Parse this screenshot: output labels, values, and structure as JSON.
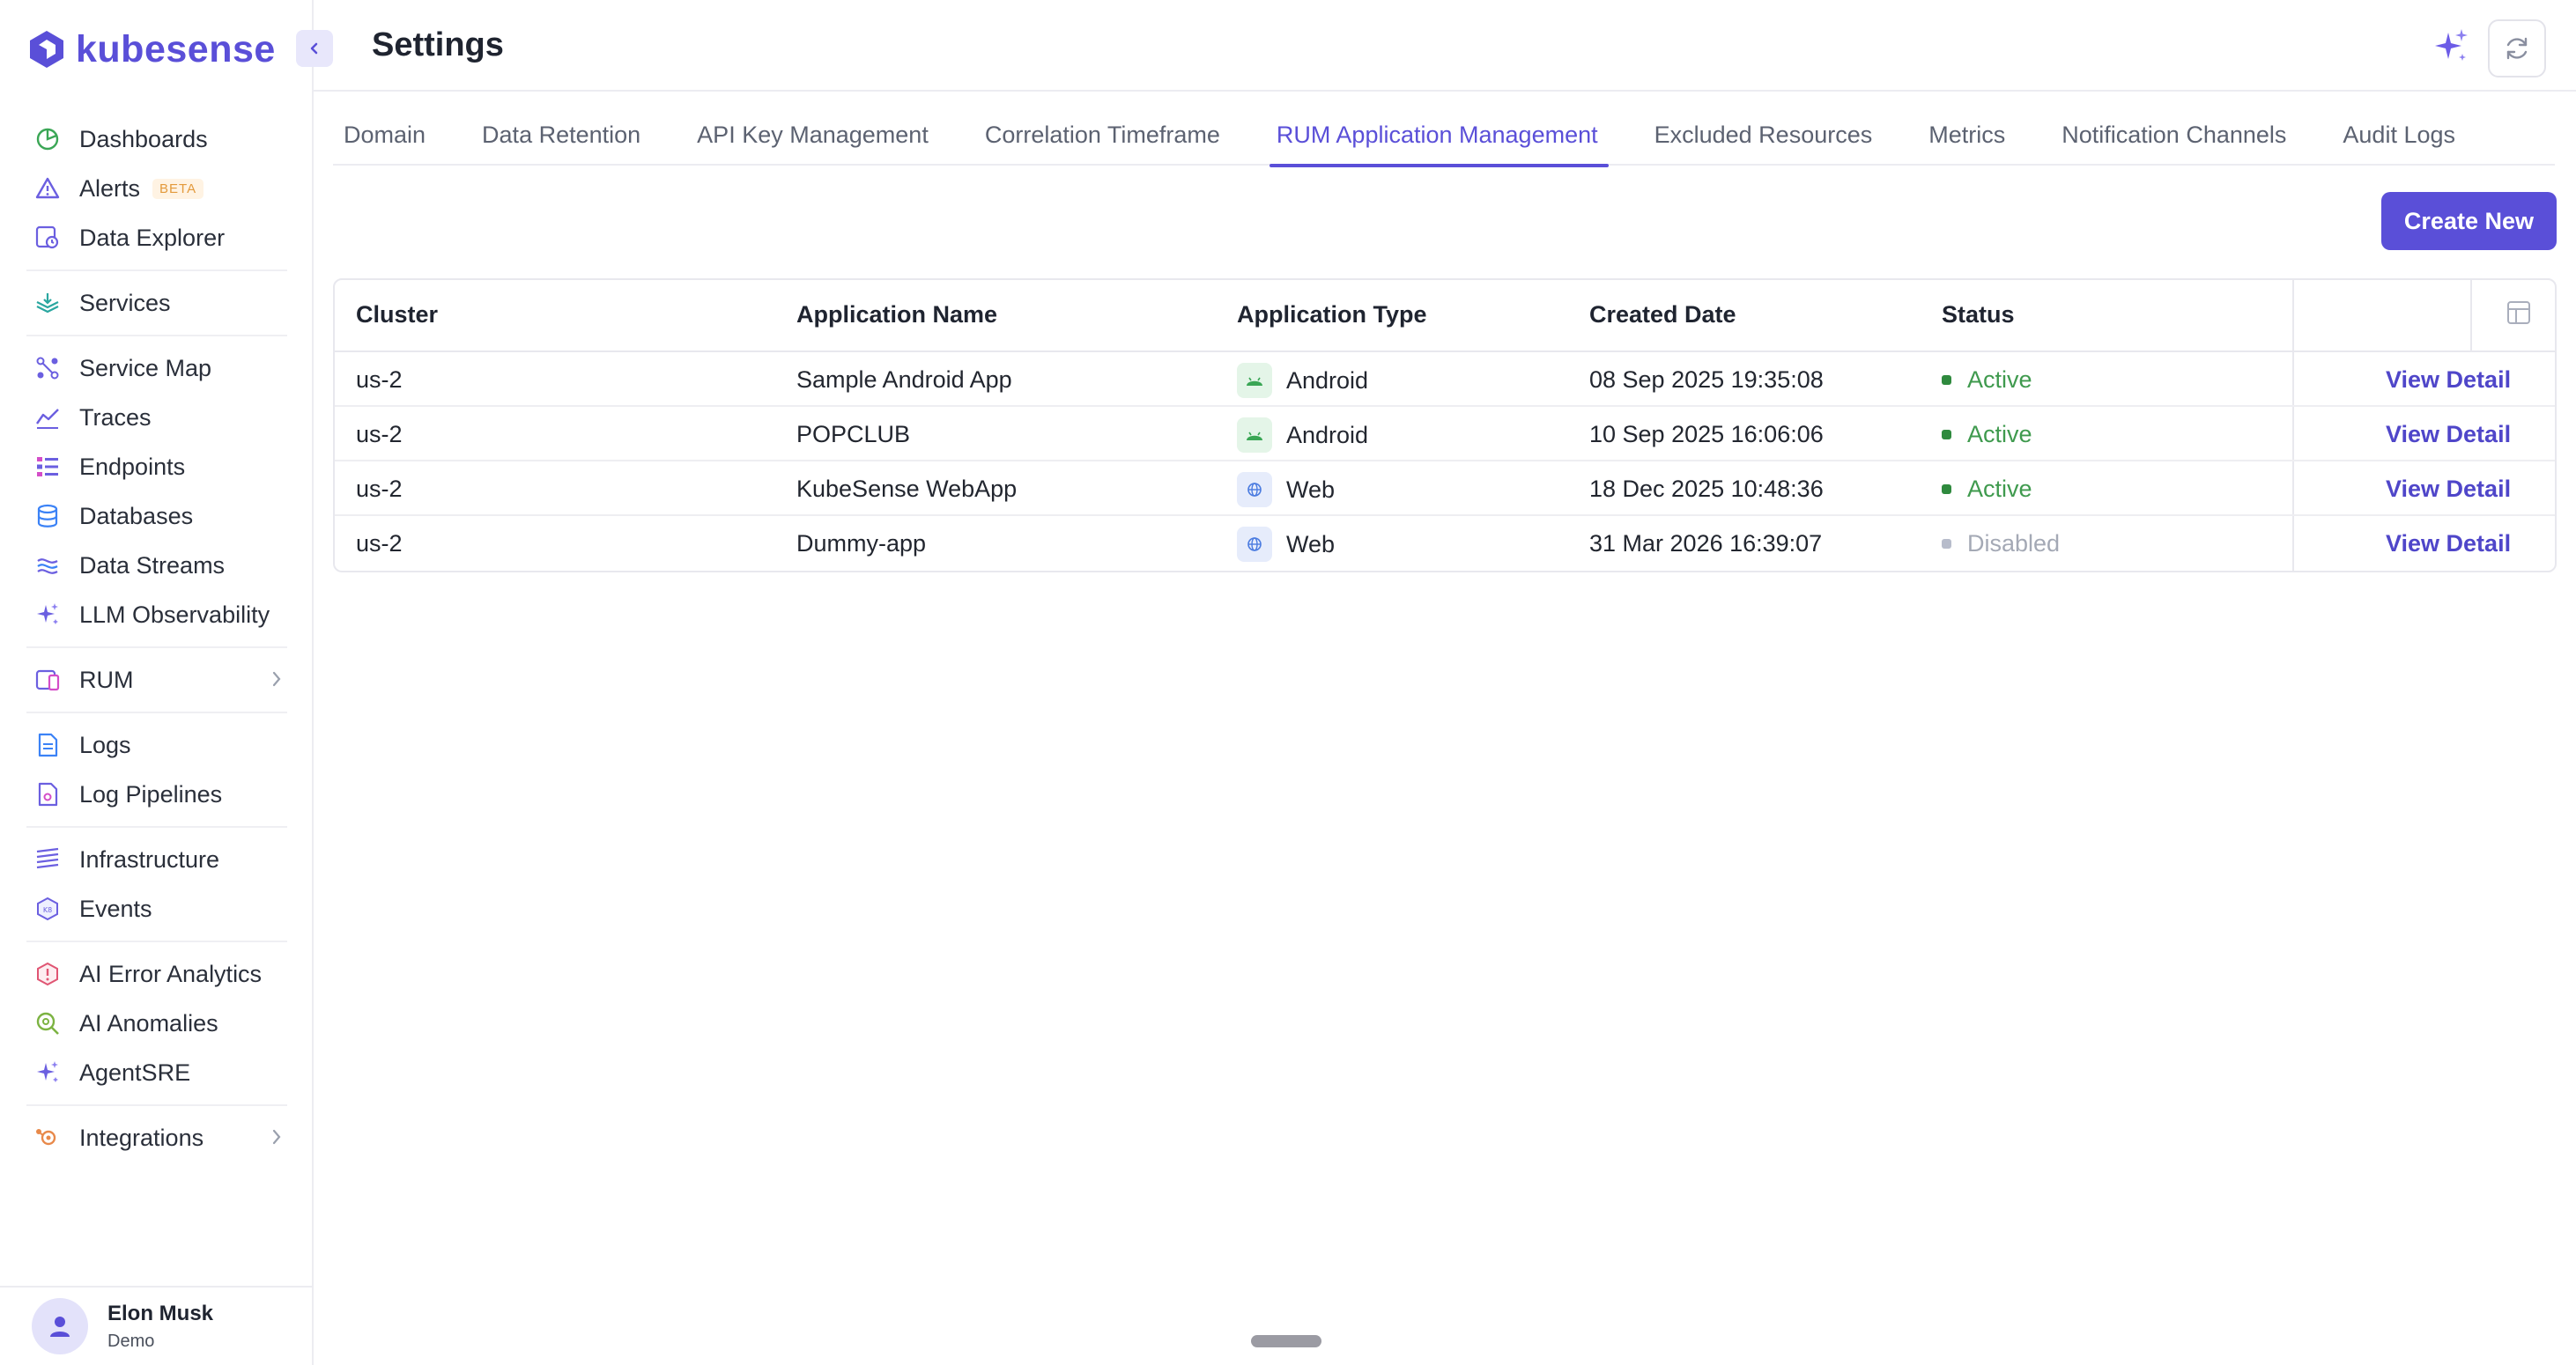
{
  "app": {
    "brand": "kubesense",
    "accent": "#5a4fd8"
  },
  "header": {
    "title": "Settings"
  },
  "sidebar": {
    "groups": [
      {
        "items": [
          {
            "label": "Dashboards",
            "icon": "dashboard-icon"
          },
          {
            "label": "Alerts",
            "icon": "alert-icon",
            "badge": "BETA"
          },
          {
            "label": "Data Explorer",
            "icon": "data-explorer-icon"
          }
        ]
      },
      {
        "items": [
          {
            "label": "Services",
            "icon": "services-icon"
          }
        ]
      },
      {
        "items": [
          {
            "label": "Service Map",
            "icon": "service-map-icon"
          },
          {
            "label": "Traces",
            "icon": "traces-icon"
          },
          {
            "label": "Endpoints",
            "icon": "endpoints-icon"
          },
          {
            "label": "Databases",
            "icon": "database-icon"
          },
          {
            "label": "Data Streams",
            "icon": "data-streams-icon"
          },
          {
            "label": "LLM Observability",
            "icon": "sparkle-icon"
          }
        ]
      },
      {
        "items": [
          {
            "label": "RUM",
            "icon": "rum-icon",
            "expandable": true
          }
        ]
      },
      {
        "items": [
          {
            "label": "Logs",
            "icon": "logs-icon"
          },
          {
            "label": "Log Pipelines",
            "icon": "log-pipelines-icon"
          }
        ]
      },
      {
        "items": [
          {
            "label": "Infrastructure",
            "icon": "infrastructure-icon"
          },
          {
            "label": "Events",
            "icon": "events-icon"
          }
        ]
      },
      {
        "items": [
          {
            "label": "AI Error Analytics",
            "icon": "ai-error-icon"
          },
          {
            "label": "AI Anomalies",
            "icon": "ai-anomalies-icon"
          },
          {
            "label": "AgentSRE",
            "icon": "sparkle-icon"
          }
        ]
      },
      {
        "items": [
          {
            "label": "Integrations",
            "icon": "integrations-icon",
            "expandable": true
          }
        ]
      }
    ],
    "user": {
      "name": "Elon Musk",
      "org": "Demo"
    }
  },
  "tabs": [
    {
      "label": "Domain"
    },
    {
      "label": "Data Retention"
    },
    {
      "label": "API Key Management"
    },
    {
      "label": "Correlation Timeframe"
    },
    {
      "label": "RUM Application Management",
      "active": true
    },
    {
      "label": "Excluded Resources"
    },
    {
      "label": "Metrics"
    },
    {
      "label": "Notification Channels"
    },
    {
      "label": "Audit Logs"
    }
  ],
  "actions": {
    "create_label": "Create New"
  },
  "table": {
    "columns": {
      "cluster": "Cluster",
      "app_name": "Application Name",
      "app_type": "Application Type",
      "created": "Created Date",
      "status": "Status"
    },
    "rows": [
      {
        "cluster": "us-2",
        "app_name": "Sample Android App",
        "app_type": "Android",
        "created": "08 Sep 2025 19:35:08",
        "status": "Active",
        "action": "View Detail"
      },
      {
        "cluster": "us-2",
        "app_name": "POPCLUB",
        "app_type": "Android",
        "created": "10 Sep 2025 16:06:06",
        "status": "Active",
        "action": "View Detail"
      },
      {
        "cluster": "us-2",
        "app_name": "KubeSense WebApp",
        "app_type": "Web",
        "created": "18 Dec 2025 10:48:36",
        "status": "Active",
        "action": "View Detail"
      },
      {
        "cluster": "us-2",
        "app_name": "Dummy-app",
        "app_type": "Web",
        "created": "31 Mar 2026 16:39:07",
        "status": "Disabled",
        "action": "View Detail"
      }
    ]
  },
  "colors": {
    "active": "#3f9a4e",
    "disabled": "#a4a9b5",
    "link": "#4f46c9"
  }
}
